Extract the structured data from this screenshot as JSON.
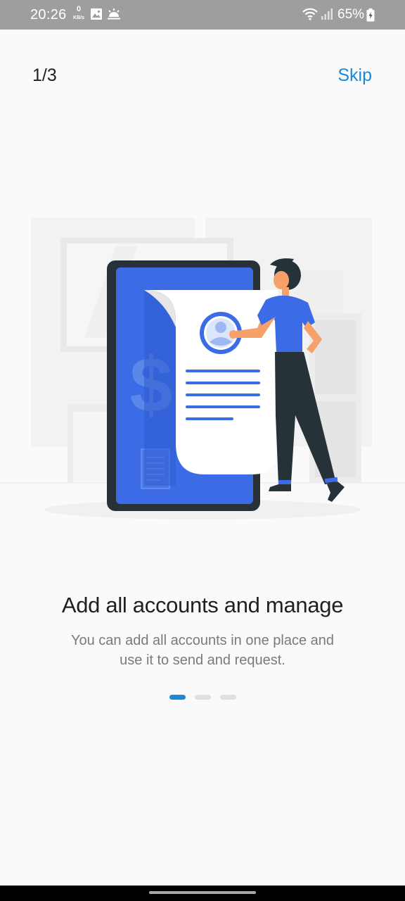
{
  "status_bar": {
    "time": "20:26",
    "net_speed_value": "0",
    "net_speed_unit": "KB/s",
    "battery_percent": "65%",
    "icons": [
      "gallery-icon",
      "weather-icon",
      "wifi-icon",
      "signal-icon",
      "battery-icon"
    ]
  },
  "header": {
    "page_counter": "1/3",
    "skip_label": "Skip"
  },
  "onboarding": {
    "title": "Add all accounts and manage",
    "subtitle": "You can add all accounts in one place and use it to send and request.",
    "illustration": "person-with-phone-and-invoice-illustration",
    "pages_total": 3,
    "current_page": 1
  },
  "colors": {
    "accent": "#1e88d6",
    "illustration_blue": "#3b6be5",
    "status_bar": "#9e9e9e",
    "background": "#fafafa"
  }
}
